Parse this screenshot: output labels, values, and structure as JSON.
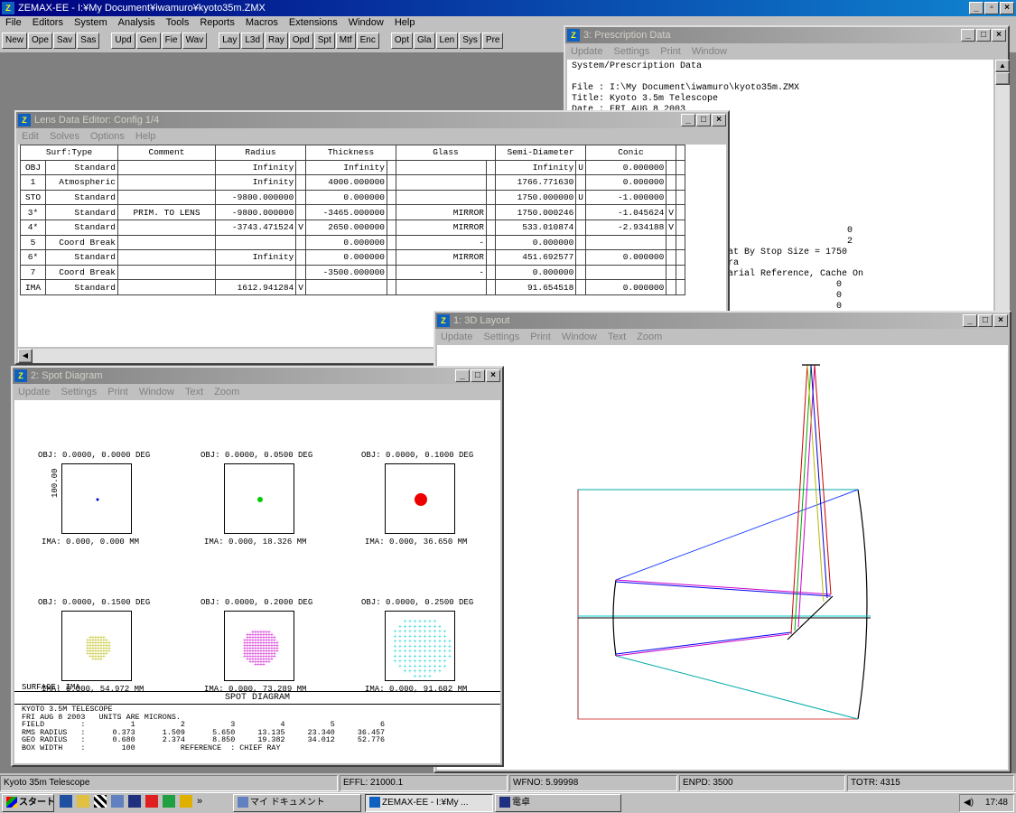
{
  "app": {
    "title": "ZEMAX-EE - I:¥My Document¥iwamuro¥kyoto35m.ZMX",
    "menu": [
      "File",
      "Editors",
      "System",
      "Analysis",
      "Tools",
      "Reports",
      "Macros",
      "Extensions",
      "Window",
      "Help"
    ],
    "toolbar_group1": [
      "New",
      "Ope",
      "Sav",
      "Sas"
    ],
    "toolbar_group2": [
      "Upd",
      "Gen",
      "Fie",
      "Wav"
    ],
    "toolbar_group3": [
      "Lay",
      "L3d",
      "Ray",
      "Opd",
      "Spt",
      "Mtf",
      "Enc"
    ],
    "toolbar_group4": [
      "Opt",
      "Gla",
      "Len",
      "Sys",
      "Pre"
    ]
  },
  "prescription": {
    "title": "3: Prescription Data",
    "menu": [
      "Update",
      "Settings",
      "Print",
      "Window"
    ],
    "lines": [
      "System/Prescription Data",
      "",
      "File : I:\\My Document\\iwamuro\\kyoto35m.ZMX",
      "Title: Kyoto 3.5m Telescope",
      "Date : FRI AUG 8 2003"
    ],
    "lines_lower": [
      "                      0",
      "                      2",
      "at By Stop Size = 1750",
      "ra",
      "arial Reference, Cache On",
      "                    0",
      "                    0",
      "                    0"
    ]
  },
  "lde": {
    "title": "Lens Data Editor: Config 1/4",
    "menu": [
      "Edit",
      "Solves",
      "Options",
      "Help"
    ],
    "headers": [
      "Surf:Type",
      "Comment",
      "Radius",
      "Thickness",
      "Glass",
      "Semi-Diameter",
      "Conic"
    ],
    "rows": [
      {
        "surf": "OBJ",
        "type": "Standard",
        "comment": "",
        "radius": "Infinity",
        "rf": "",
        "thick": "Infinity",
        "tf": "",
        "glass": "",
        "gf": "",
        "semi": "Infinity",
        "sf": "U",
        "conic": "0.000000",
        "cf": ""
      },
      {
        "surf": "1",
        "type": "Atmospheric",
        "comment": "",
        "radius": "Infinity",
        "rf": "",
        "thick": "4000.000000",
        "tf": "",
        "glass": "",
        "gf": "",
        "semi": "1766.771630",
        "sf": "",
        "conic": "0.000000",
        "cf": ""
      },
      {
        "surf": "STO",
        "type": "Standard",
        "comment": "",
        "radius": "-9800.000000",
        "rf": "",
        "thick": "0.000000",
        "tf": "",
        "glass": "",
        "gf": "",
        "semi": "1750.000000",
        "sf": "U",
        "conic": "-1.000000",
        "cf": ""
      },
      {
        "surf": "3*",
        "type": "Standard",
        "comment": "PRIM. TO LENS",
        "radius": "-9800.000000",
        "rf": "",
        "thick": "-3465.000000",
        "tf": "",
        "glass": "MIRROR",
        "gf": "",
        "semi": "1750.000246",
        "sf": "",
        "conic": "-1.045624",
        "cf": "V"
      },
      {
        "surf": "4*",
        "type": "Standard",
        "comment": "",
        "radius": "-3743.471524",
        "rf": "V",
        "thick": "2650.000000",
        "tf": "",
        "glass": "MIRROR",
        "gf": "",
        "semi": "533.010874",
        "sf": "",
        "conic": "-2.934188",
        "cf": "V"
      },
      {
        "surf": "5",
        "type": "Coord Break",
        "comment": "",
        "radius": "",
        "rf": "",
        "thick": "0.000000",
        "tf": "",
        "glass": "-",
        "gf": "",
        "semi": "0.000000",
        "sf": "",
        "conic": "",
        "cf": ""
      },
      {
        "surf": "6*",
        "type": "Standard",
        "comment": "",
        "radius": "Infinity",
        "rf": "",
        "thick": "0.000000",
        "tf": "",
        "glass": "MIRROR",
        "gf": "",
        "semi": "451.692577",
        "sf": "",
        "conic": "0.000000",
        "cf": ""
      },
      {
        "surf": "7",
        "type": "Coord Break",
        "comment": "",
        "radius": "",
        "rf": "",
        "thick": "-3500.000000",
        "tf": "",
        "glass": "-",
        "gf": "",
        "semi": "0.000000",
        "sf": "",
        "conic": "",
        "cf": ""
      },
      {
        "surf": "IMA",
        "type": "Standard",
        "comment": "",
        "radius": "1612.941284",
        "rf": "V",
        "thick": "",
        "tf": "",
        "glass": "",
        "gf": "",
        "semi": "91.654518",
        "sf": "",
        "conic": "0.000000",
        "cf": ""
      }
    ]
  },
  "layout3d": {
    "title": "1: 3D Layout",
    "menu": [
      "Update",
      "Settings",
      "Print",
      "Window",
      "Text",
      "Zoom"
    ]
  },
  "spot": {
    "title": "2: Spot Diagram",
    "menu": [
      "Update",
      "Settings",
      "Print",
      "Window",
      "Text",
      "Zoom"
    ],
    "fields": [
      {
        "obj": "OBJ: 0.0000, 0.0000 DEG",
        "ima": "IMA: 0.000, 0.000 MM",
        "color": "#0000cc"
      },
      {
        "obj": "OBJ: 0.0000, 0.0500 DEG",
        "ima": "IMA: 0.000, 18.326 MM",
        "color": "#00cc00"
      },
      {
        "obj": "OBJ: 0.0000, 0.1000 DEG",
        "ima": "IMA: 0.000, 36.650 MM",
        "color": "#ee0000"
      },
      {
        "obj": "OBJ: 0.0000, 0.1500 DEG",
        "ima": "IMA: 0.000, 54.972 MM",
        "color": "#b8b800"
      },
      {
        "obj": "OBJ: 0.0000, 0.2000 DEG",
        "ima": "IMA: 0.000, 73.289 MM",
        "color": "#cc00cc"
      },
      {
        "obj": "OBJ: 0.0000, 0.2500 DEG",
        "ima": "IMA: 0.000, 91.602 MM",
        "color": "#00cccc"
      }
    ],
    "scale_label": "100.00",
    "surface": "SURFACE: IMA",
    "heading": "SPOT DIAGRAM",
    "footer": [
      "KYOTO 3.5M TELESCOPE",
      "FRI AUG 8 2003   UNITS ARE MICRONS.",
      "FIELD        :          1          2          3          4          5          6",
      "RMS RADIUS   :      0.373      1.509      5.650     13.135     23.340     36.457",
      "GEO RADIUS   :      0.680      2.374      8.850     19.382     34.012     52.776",
      "BOX WIDTH    :        100          REFERENCE  : CHIEF RAY"
    ]
  },
  "statusbar": [
    "Kyoto 35m Telescope",
    "EFFL: 21000.1",
    "WFNO: 5.99998",
    "ENPD: 3500",
    "TOTR: 4315"
  ],
  "taskbar": {
    "start": "スタート",
    "tasks": [
      "マイ ドキュメント",
      "ZEMAX-EE - I:¥My ...",
      "電卓"
    ],
    "clock": "17:48"
  }
}
